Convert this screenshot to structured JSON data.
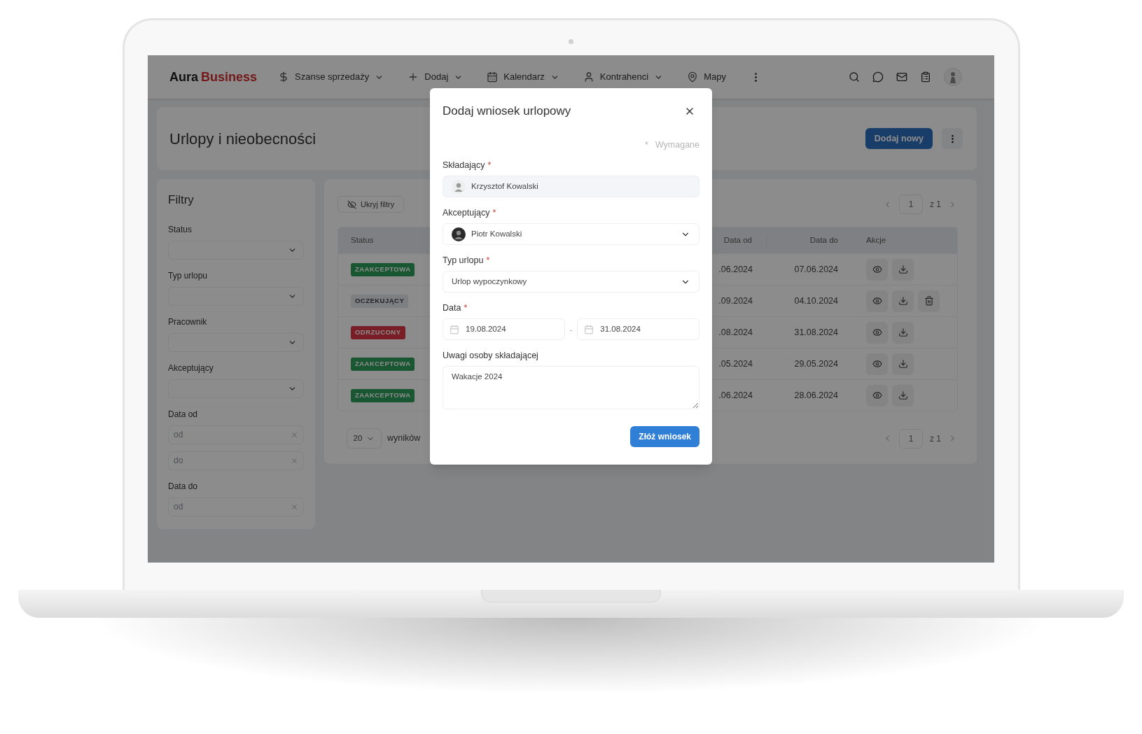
{
  "nav": {
    "logo_first": "Aura",
    "logo_second": "Business",
    "items": [
      {
        "label": "Szanse sprzedaży",
        "has_menu": true
      },
      {
        "label": "Dodaj",
        "has_menu": true
      },
      {
        "label": "Kalendarz",
        "has_menu": true
      },
      {
        "label": "Kontrahenci",
        "has_menu": true
      },
      {
        "label": "Mapy",
        "has_menu": false
      }
    ]
  },
  "page": {
    "title": "Urlopy i nieobecności",
    "add_button": "Dodaj nowy"
  },
  "filters": {
    "title": "Filtry",
    "fields": [
      {
        "label": "Status",
        "kind": "select"
      },
      {
        "label": "Typ urlopu",
        "kind": "select"
      },
      {
        "label": "Pracownik",
        "kind": "select"
      },
      {
        "label": "Akceptujący",
        "kind": "select"
      },
      {
        "label": "Data od",
        "kind": "range",
        "placeholders": [
          "od",
          "do"
        ]
      },
      {
        "label": "Data do",
        "kind": "range",
        "placeholders": [
          "od"
        ]
      }
    ]
  },
  "table": {
    "hide_filters": "Ukryj filtry",
    "pagination_top": {
      "page": "1",
      "of": "z 1"
    },
    "columns": [
      "Status",
      "Data od",
      "Data do",
      "Akcje"
    ],
    "rows": [
      {
        "status": "ZAAKCEPTOWA",
        "kind": "accepted",
        "date_from": ".06.2024",
        "date_to": "07.06.2024",
        "can_delete": false
      },
      {
        "status": "OCZEKUJĄCY",
        "kind": "pending",
        "date_from": ".09.2024",
        "date_to": "04.10.2024",
        "can_delete": true
      },
      {
        "status": "ODRZUCONY",
        "kind": "rejected",
        "date_from": ".08.2024",
        "date_to": "31.08.2024",
        "can_delete": false
      },
      {
        "status": "ZAAKCEPTOWA",
        "kind": "accepted",
        "date_from": ".05.2024",
        "date_to": "29.05.2024",
        "can_delete": false
      },
      {
        "status": "ZAAKCEPTOWA",
        "kind": "accepted",
        "date_from": ".06.2024",
        "date_to": "28.06.2024",
        "can_delete": false
      }
    ],
    "page_size": "20",
    "page_size_label": "wyników",
    "pagination_bottom": {
      "page": "1",
      "of": "z 1"
    }
  },
  "modal": {
    "title": "Dodaj wniosek urlopowy",
    "required_mark": "*",
    "required_note": "Wymagane",
    "fields": [
      {
        "label": "Składający",
        "required": true,
        "kind": "person",
        "value": "Krzysztof Kowalski",
        "disabled": true
      },
      {
        "label": "Akceptujący",
        "required": true,
        "kind": "person_select",
        "value": "Piotr Kowalski",
        "disabled": false
      },
      {
        "label": "Typ urlopu",
        "required": true,
        "kind": "select",
        "value": "Urlop wypoczynkowy",
        "disabled": false
      },
      {
        "label": "Data",
        "required": true,
        "kind": "date_range",
        "from": "19.08.2024",
        "separator": "-",
        "to": "31.08.2024"
      },
      {
        "label": "Uwagi osoby składającej",
        "required": false,
        "kind": "textarea",
        "value": "Wakacje 2024"
      }
    ],
    "submit": "Złóż wniosek"
  }
}
